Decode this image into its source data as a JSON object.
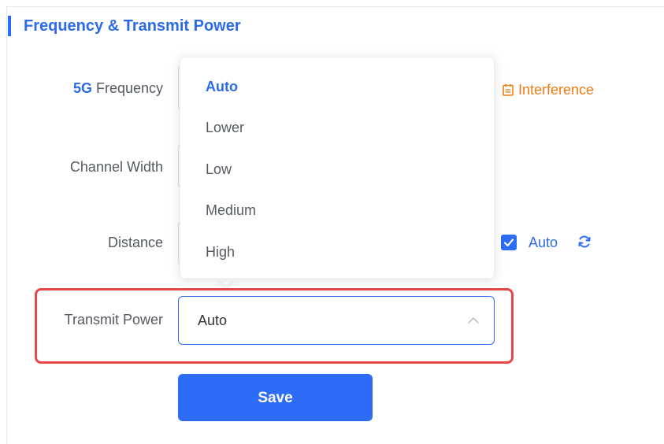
{
  "section": {
    "title": "Frequency & Transmit Power"
  },
  "rows": {
    "frequency": {
      "band": "5G",
      "label": " Frequency"
    },
    "channel_width": {
      "label": "Channel Width"
    },
    "distance": {
      "label": "Distance"
    },
    "transmit_power": {
      "label": "Transmit Power"
    }
  },
  "interference": {
    "label": "Interference",
    "icon": "calendar-icon",
    "color": "#ee7a14"
  },
  "distance_auto": {
    "checked": true,
    "label": "Auto",
    "refresh_icon": "refresh-icon"
  },
  "transmit_select": {
    "value": "Auto",
    "arrow_icon": "chevron-up-icon"
  },
  "dropdown": {
    "options": [
      "Auto",
      "Lower",
      "Low",
      "Medium",
      "High"
    ],
    "selected": "Auto"
  },
  "save_button": {
    "label": "Save"
  },
  "colors": {
    "accent": "#2d6cf6",
    "highlight": "#e8474a",
    "warning": "#ee7a14"
  }
}
